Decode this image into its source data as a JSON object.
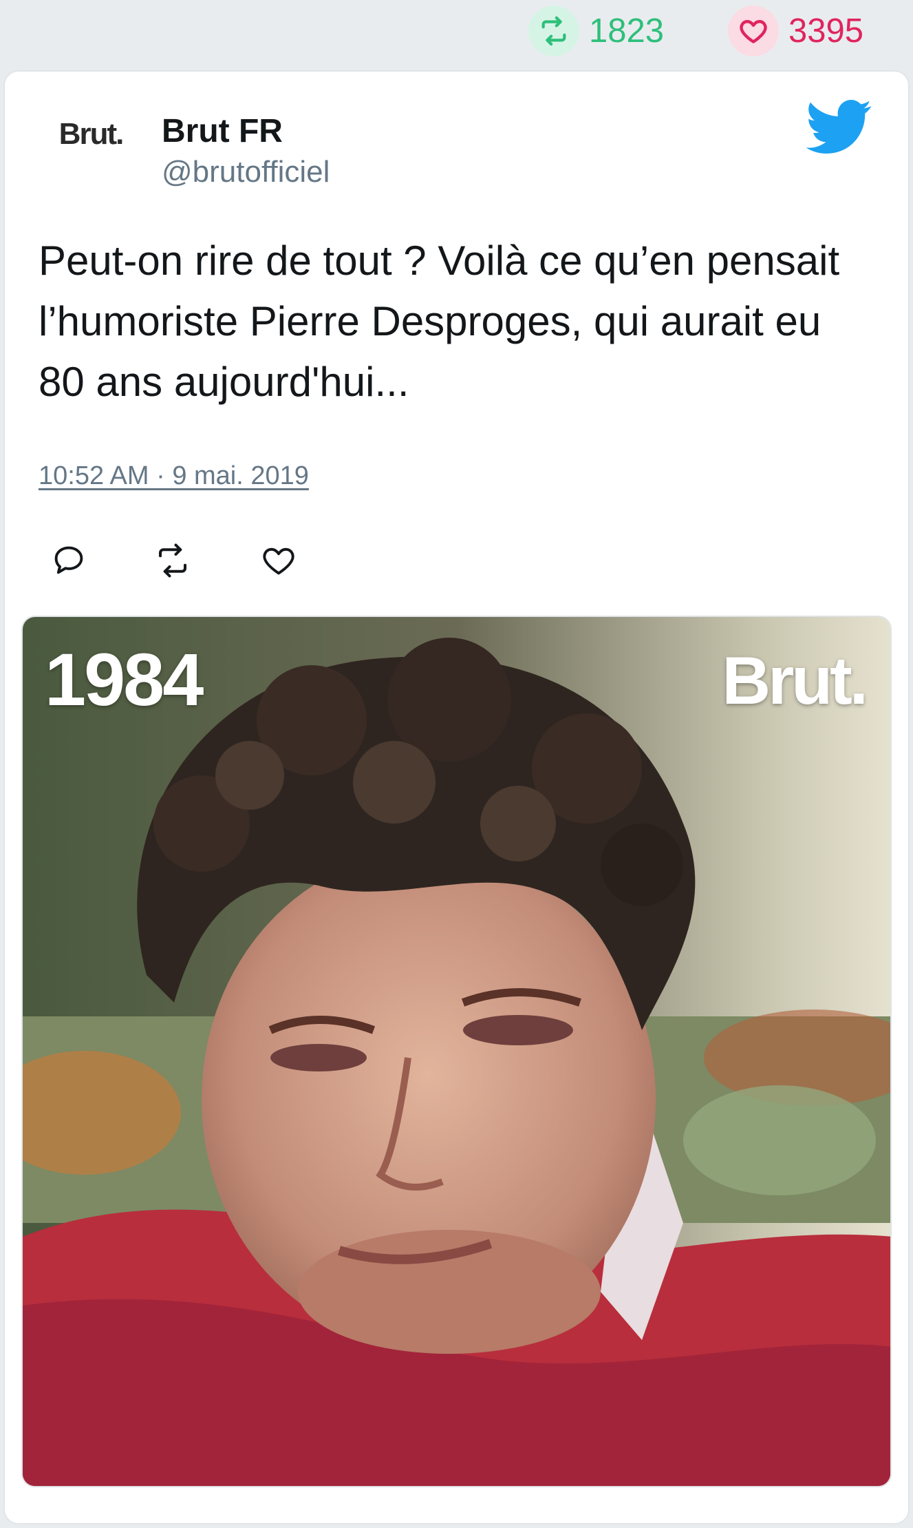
{
  "stats": {
    "retweets": "1823",
    "likes": "3395",
    "retweet_icon": "retweet-icon",
    "like_icon": "heart-icon",
    "retweet_color": "#2ebf7a",
    "like_color": "#e0245e"
  },
  "tweet": {
    "avatar_text": "Brut.",
    "author_name": "Brut FR",
    "author_handle": "@brutofficiel",
    "platform_icon": "twitter-bird-icon",
    "platform_color": "#1da1f2",
    "text": "Peut-on rire de tout ? Voilà ce qu’en pensait l’humoriste Pierre Desproges, qui aurait eu 80 ans aujourd'hui...",
    "timestamp": "10:52 AM · 9 mai. 2019",
    "actions": [
      "reply-icon",
      "retweet-icon",
      "like-icon"
    ]
  },
  "media": {
    "year_label": "1984",
    "brand_label": "Brut.",
    "alt_subject": "video still of a curly-haired man in a red sweater"
  }
}
